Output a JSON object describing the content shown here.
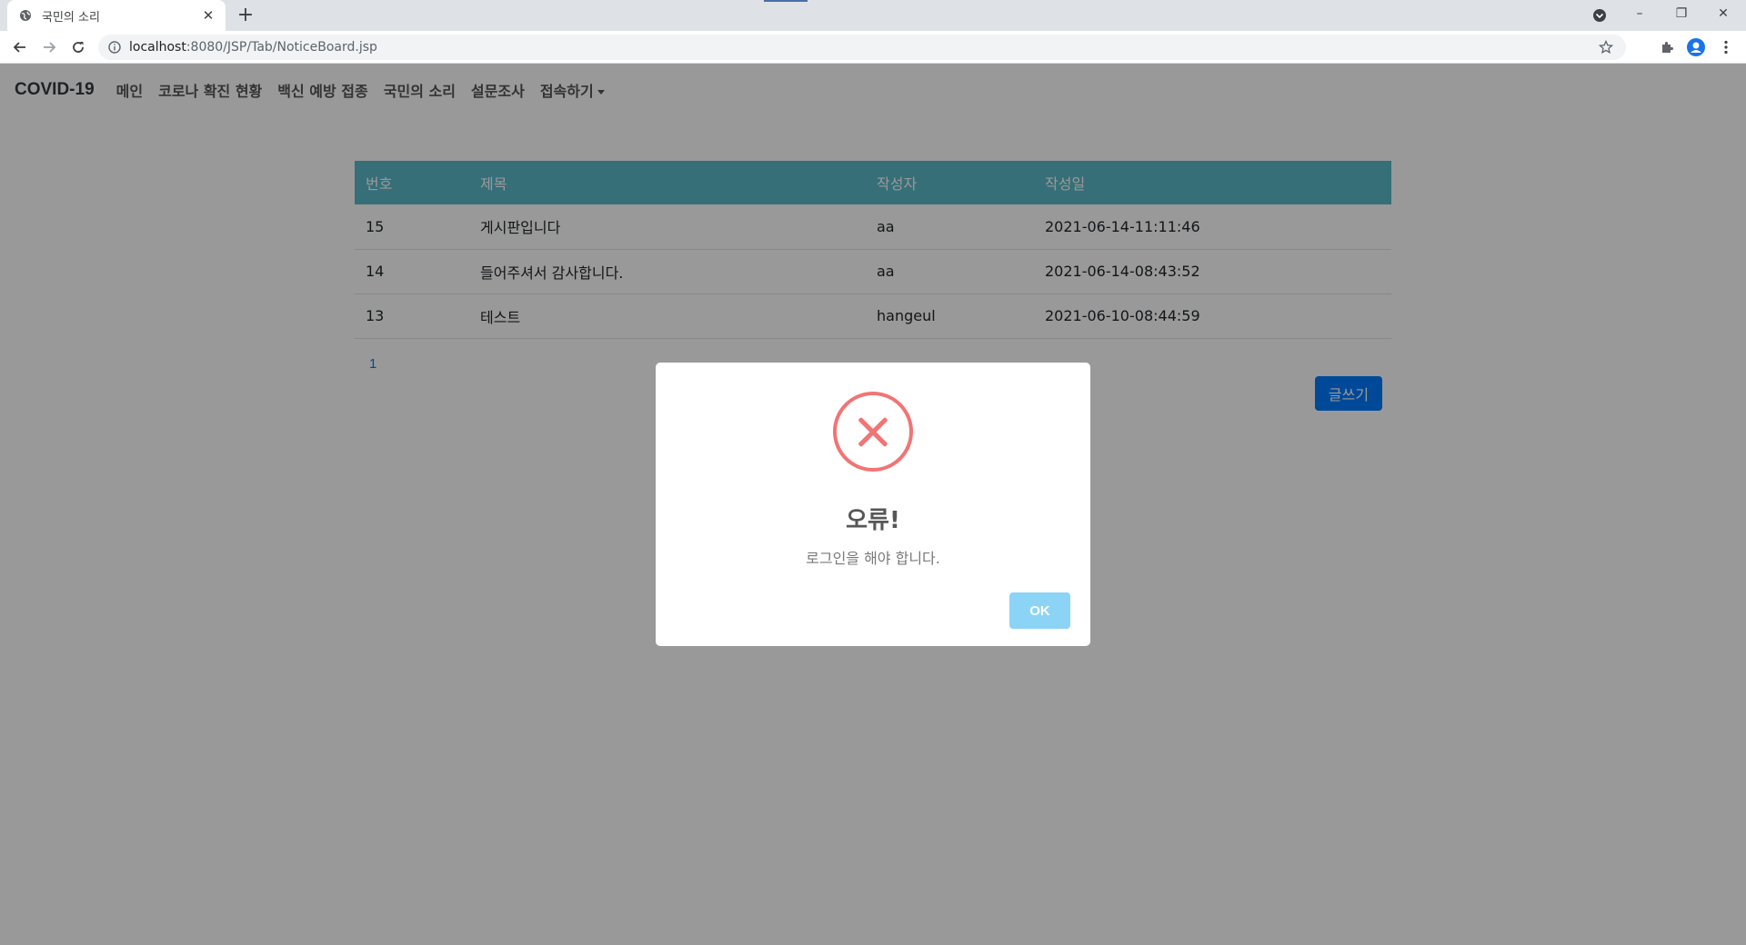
{
  "browser": {
    "tab_title": "국민의 소리",
    "tab_close": "✕",
    "new_tab": "+",
    "url_host": "localhost",
    "url_path": ":8080/JSP/Tab/NoticeBoard.jsp",
    "window_controls": {
      "minimize": "–",
      "restore": "❐",
      "close": "✕"
    }
  },
  "navbar": {
    "brand": "COVID-19",
    "links": [
      "메인",
      "코로나 확진 현황",
      "백신 예방 접종",
      "국민의 소리",
      "설문조사",
      "접속하기"
    ]
  },
  "board": {
    "headers": [
      "번호",
      "제목",
      "작성자",
      "작성일"
    ],
    "rows": [
      {
        "no": "15",
        "title": "게시판입니다",
        "writer": "aa",
        "date": "2021-06-14-11:11:46"
      },
      {
        "no": "14",
        "title": "들어주셔서 감사합니다.",
        "writer": "aa",
        "date": "2021-06-14-08:43:52"
      },
      {
        "no": "13",
        "title": "테스트",
        "writer": "hangeul",
        "date": "2021-06-10-08:44:59"
      }
    ],
    "page": "1",
    "write_button": "글쓰기"
  },
  "modal": {
    "icon": "error-x-icon",
    "title": "오류!",
    "text": "로그인을 해야 합니다.",
    "ok_button": "OK"
  },
  "colors": {
    "table_header": "#5bbac9",
    "primary": "#007bff",
    "error": "#f27474",
    "ok_button": "#8cd4f5"
  }
}
